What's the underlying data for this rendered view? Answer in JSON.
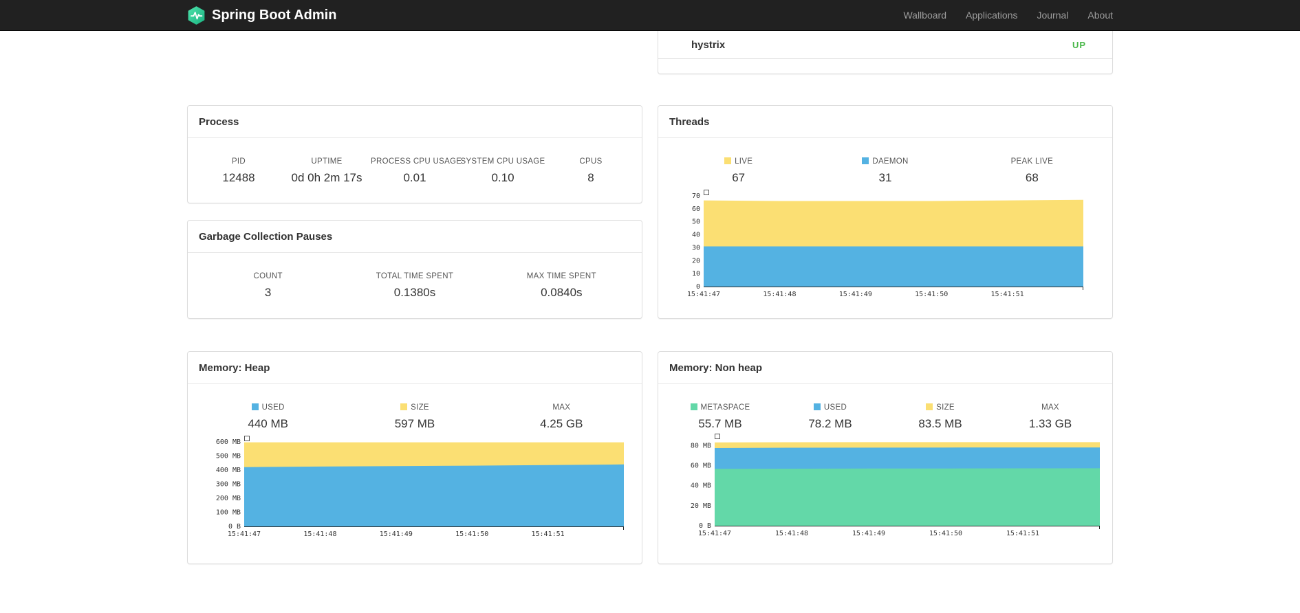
{
  "colors": {
    "yellow": "#fbdf73",
    "blue": "#54b2e2",
    "green": "#63d8a8",
    "up": "#49b749",
    "brand_teal": "#3ecf9c"
  },
  "navbar": {
    "brand": "Spring Boot Admin",
    "items": [
      {
        "label": "Wallboard"
      },
      {
        "label": "Applications"
      },
      {
        "label": "Journal"
      },
      {
        "label": "About"
      }
    ]
  },
  "status_card": {
    "app_name": "hystrix",
    "status": "UP"
  },
  "process": {
    "title": "Process",
    "metrics": [
      {
        "label": "PID",
        "value": "12488"
      },
      {
        "label": "UPTIME",
        "value": "0d 0h 2m 17s"
      },
      {
        "label": "PROCESS CPU USAGE",
        "value": "0.01"
      },
      {
        "label": "SYSTEM CPU USAGE",
        "value": "0.10"
      },
      {
        "label": "CPUS",
        "value": "8"
      }
    ]
  },
  "gc": {
    "title": "Garbage Collection Pauses",
    "metrics": [
      {
        "label": "COUNT",
        "value": "3"
      },
      {
        "label": "TOTAL TIME SPENT",
        "value": "0.1380s"
      },
      {
        "label": "MAX TIME SPENT",
        "value": "0.0840s"
      }
    ]
  },
  "threads": {
    "title": "Threads",
    "legend": [
      {
        "label": "LIVE",
        "value": "67",
        "color": "yellow"
      },
      {
        "label": "DAEMON",
        "value": "31",
        "color": "blue"
      },
      {
        "label": "PEAK LIVE",
        "value": "68",
        "color": null
      }
    ]
  },
  "memory_heap": {
    "title": "Memory: Heap",
    "legend": [
      {
        "label": "USED",
        "value": "440 MB",
        "color": "blue"
      },
      {
        "label": "SIZE",
        "value": "597 MB",
        "color": "yellow"
      },
      {
        "label": "MAX",
        "value": "4.25 GB",
        "color": null
      }
    ]
  },
  "memory_nonheap": {
    "title": "Memory: Non heap",
    "legend": [
      {
        "label": "METASPACE",
        "value": "55.7 MB",
        "color": "green"
      },
      {
        "label": "USED",
        "value": "78.2 MB",
        "color": "blue"
      },
      {
        "label": "SIZE",
        "value": "83.5 MB",
        "color": "yellow"
      },
      {
        "label": "MAX",
        "value": "1.33 GB",
        "color": null
      }
    ]
  },
  "chart_data": [
    {
      "key": "threads",
      "type": "area",
      "title": "Threads",
      "x_labels": [
        "15:41:47",
        "15:41:48",
        "15:41:49",
        "15:41:50",
        "15:41:51"
      ],
      "x_label_step": 0.2,
      "y_max": 70,
      "y_ticks": [
        {
          "v": 0,
          "label": "0"
        },
        {
          "v": 10,
          "label": "10"
        },
        {
          "v": 20,
          "label": "20"
        },
        {
          "v": 30,
          "label": "30"
        },
        {
          "v": 40,
          "label": "40"
        },
        {
          "v": 50,
          "label": "50"
        },
        {
          "v": 60,
          "label": "60"
        },
        {
          "v": 70,
          "label": "70"
        }
      ],
      "series": [
        {
          "name": "live",
          "color": "yellow",
          "values": [
            66.5,
            66,
            66,
            66,
            66.5,
            67
          ]
        },
        {
          "name": "daemon",
          "color": "blue",
          "values": [
            31,
            31,
            31,
            31,
            31,
            31
          ]
        }
      ]
    },
    {
      "key": "heap",
      "type": "area",
      "title": "Memory: Heap",
      "x_labels": [
        "15:41:47",
        "15:41:48",
        "15:41:49",
        "15:41:50",
        "15:41:51"
      ],
      "x_label_step": 0.2,
      "y_max": 600,
      "y_ticks": [
        {
          "v": 0,
          "label": "0 B"
        },
        {
          "v": 100,
          "label": "100 MB"
        },
        {
          "v": 200,
          "label": "200 MB"
        },
        {
          "v": 300,
          "label": "300 MB"
        },
        {
          "v": 400,
          "label": "400 MB"
        },
        {
          "v": 500,
          "label": "500 MB"
        },
        {
          "v": 600,
          "label": "600 MB"
        }
      ],
      "series": [
        {
          "name": "size",
          "color": "yellow",
          "values": [
            597,
            597,
            597,
            597,
            597,
            597
          ]
        },
        {
          "name": "used",
          "color": "blue",
          "values": [
            421,
            425,
            428,
            431,
            435,
            440
          ]
        }
      ]
    },
    {
      "key": "nonheap",
      "type": "area",
      "title": "Memory: Non heap",
      "x_labels": [
        "15:41:47",
        "15:41:48",
        "15:41:49",
        "15:41:50",
        "15:41:51"
      ],
      "x_label_step": 0.2,
      "y_max": 86.5,
      "y_ticks": [
        {
          "v": 0,
          "label": "0 B"
        },
        {
          "v": 20,
          "label": "20 MB"
        },
        {
          "v": 40,
          "label": "40 MB"
        },
        {
          "v": 60,
          "label": "60 MB"
        },
        {
          "v": 80,
          "label": "80 MB"
        }
      ],
      "series": [
        {
          "name": "size",
          "color": "yellow",
          "values": [
            83.3,
            83.4,
            83.5,
            83.5,
            83.5,
            83.5
          ]
        },
        {
          "name": "used",
          "color": "blue",
          "values": [
            77.6,
            77.9,
            78,
            78.1,
            78.2,
            78.2
          ]
        },
        {
          "name": "metaspace",
          "color": "green",
          "values": [
            56.8,
            57,
            57.1,
            57.2,
            57.3,
            57.4
          ]
        }
      ]
    }
  ]
}
